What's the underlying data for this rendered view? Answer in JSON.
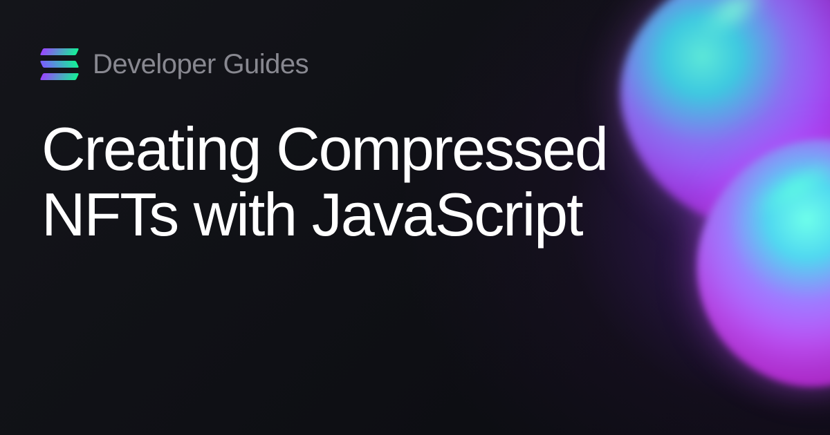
{
  "header": {
    "subtitle": "Developer Guides"
  },
  "main": {
    "title": "Creating Compressed NFTs with JavaScript"
  }
}
